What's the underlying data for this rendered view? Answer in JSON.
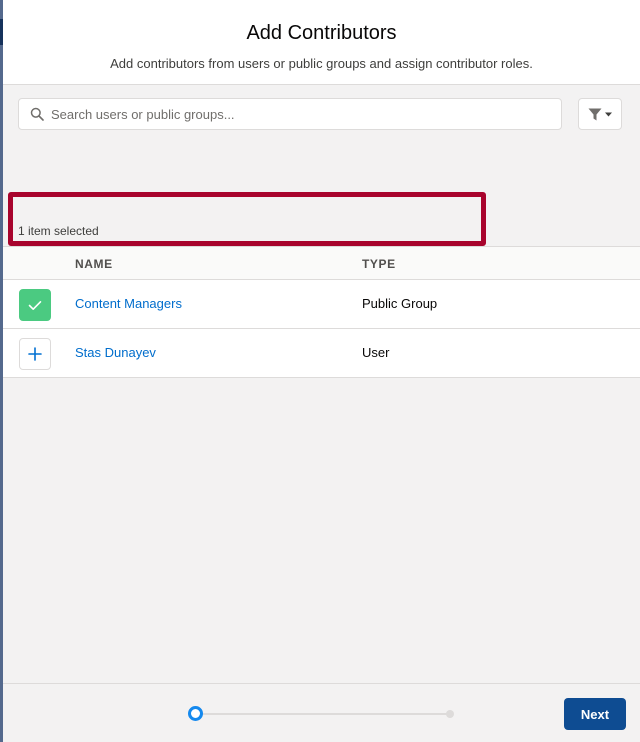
{
  "modal": {
    "title": "Add Contributors",
    "subtitle": "Add contributors from users or public groups and assign contributor roles."
  },
  "search": {
    "placeholder": "Search users or public groups...",
    "value": ""
  },
  "filter": {
    "icon": "filter-icon",
    "dropdown_icon": "caret-down-icon"
  },
  "selection": {
    "count_text": "1 item selected"
  },
  "table": {
    "columns": [
      "NAME",
      "TYPE"
    ],
    "rows": [
      {
        "name": "Content Managers",
        "type": "Public Group",
        "selected": true
      },
      {
        "name": "Stas Dunayev",
        "type": "User",
        "selected": false
      }
    ]
  },
  "footer": {
    "next_label": "Next",
    "progress": {
      "total_steps": 2,
      "current_step": 1
    }
  },
  "colors": {
    "selected": "#4bca81",
    "link": "#006dcc",
    "brand_button": "#0e4c92",
    "highlight": "#a8042d",
    "progress_active": "#1589ee"
  }
}
